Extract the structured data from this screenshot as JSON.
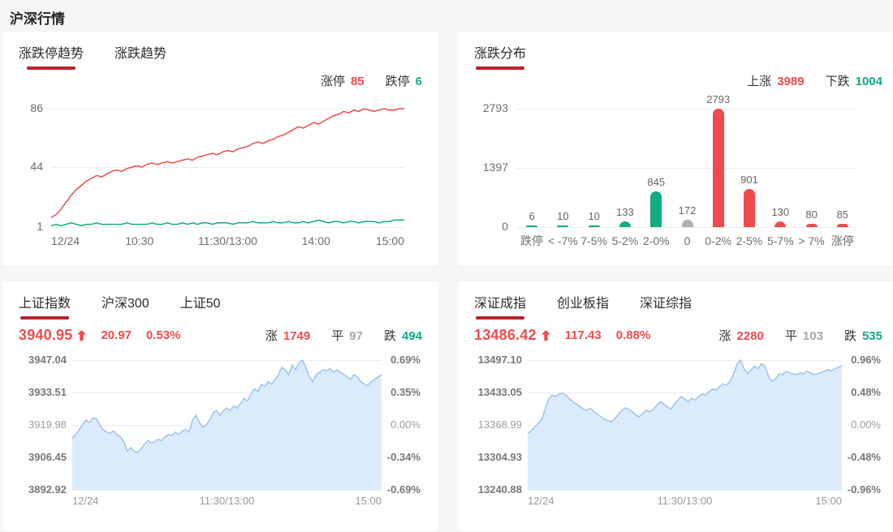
{
  "page": {
    "title": "沪深行情"
  },
  "colors": {
    "red": "#f04a4c",
    "green": "#10ab87",
    "underline": "#b5232c",
    "gray_text": "#a8a8a8",
    "bar_gray": "#b0b0b0",
    "area_line": "#9cc3ee",
    "area_fill": "#dcebfb",
    "grid_line": "#ececec",
    "page_bg": "#f5f6f8",
    "panel_bg": "#ffffff"
  },
  "panels": {
    "limit_trend": {
      "tabs": [
        {
          "label": "涨跌停趋势",
          "active": true
        },
        {
          "label": "涨跌趋势",
          "active": false
        }
      ],
      "stats": [
        {
          "label": "涨停",
          "value": "85",
          "color": "red"
        },
        {
          "label": "跌停",
          "value": "6",
          "color": "green"
        }
      ]
    },
    "distribution": {
      "tabs": [
        {
          "label": "涨跌分布",
          "active": true
        }
      ],
      "stats": [
        {
          "label": "上涨",
          "value": "3989",
          "color": "red"
        },
        {
          "label": "下跌",
          "value": "1004",
          "color": "green"
        }
      ]
    },
    "sh_index": {
      "tabs": [
        {
          "label": "上证指数",
          "active": true
        },
        {
          "label": "沪深300",
          "active": false
        },
        {
          "label": "上证50",
          "active": false
        }
      ],
      "quote": {
        "price": "3940.95",
        "direction": "up",
        "change": "20.97",
        "pct": "0.53%"
      },
      "stats": [
        {
          "label": "涨",
          "value": "1749",
          "color": "red"
        },
        {
          "label": "平",
          "value": "97",
          "color": "gray"
        },
        {
          "label": "跌",
          "value": "494",
          "color": "green"
        }
      ]
    },
    "sz_index": {
      "tabs": [
        {
          "label": "深证成指",
          "active": true
        },
        {
          "label": "创业板指",
          "active": false
        },
        {
          "label": "深证综指",
          "active": false
        }
      ],
      "quote": {
        "price": "13486.42",
        "direction": "up",
        "change": "117.43",
        "pct": "0.88%"
      },
      "stats": [
        {
          "label": "涨",
          "value": "2280",
          "color": "red"
        },
        {
          "label": "平",
          "value": "103",
          "color": "gray"
        },
        {
          "label": "跌",
          "value": "535",
          "color": "green"
        }
      ]
    }
  },
  "chart_data": [
    {
      "type": "line",
      "title": "涨跌停趋势",
      "x_ticks": [
        "12/24",
        "10:30",
        "11:30/13:00",
        "14:00",
        "15:00"
      ],
      "y_ticks": [
        86,
        44,
        1
      ],
      "ylim": [
        1,
        86
      ],
      "grid": true,
      "legend_position": "none",
      "series": [
        {
          "name": "涨停",
          "color_key": "red",
          "values": [
            8,
            10,
            14,
            19,
            24,
            28,
            31,
            34,
            36,
            38,
            37,
            39,
            41,
            42,
            41,
            43,
            44,
            45,
            44,
            46,
            47,
            46,
            47,
            48,
            47,
            48,
            49,
            50,
            49,
            51,
            52,
            53,
            54,
            53,
            55,
            56,
            55,
            57,
            58,
            59,
            61,
            62,
            61,
            63,
            64,
            66,
            67,
            69,
            71,
            73,
            72,
            74,
            76,
            75,
            77,
            79,
            81,
            82,
            84,
            83,
            85,
            84,
            86,
            85,
            84,
            85,
            86,
            85,
            85,
            86,
            86
          ]
        },
        {
          "name": "跌停",
          "color_key": "green",
          "values": [
            2,
            3,
            2,
            3,
            4,
            3,
            2,
            3,
            3,
            4,
            3,
            3,
            3,
            3,
            3,
            4,
            3,
            3,
            3,
            3,
            4,
            3,
            3,
            4,
            3,
            3,
            4,
            3,
            4,
            3,
            4,
            4,
            3,
            4,
            4,
            4,
            3,
            4,
            4,
            4,
            5,
            4,
            4,
            4,
            5,
            4,
            4,
            5,
            4,
            4,
            5,
            4,
            5,
            6,
            5,
            4,
            5,
            5,
            4,
            5,
            5,
            4,
            5,
            5,
            5,
            4,
            5,
            5,
            6,
            6,
            6
          ]
        }
      ]
    },
    {
      "type": "bar",
      "title": "涨跌分布",
      "categories": [
        "跌停",
        "< -7%",
        "7-5%",
        "5-2%",
        "2-0%",
        "0",
        "0-2%",
        "2-5%",
        "5-7%",
        "> 7%",
        "涨停"
      ],
      "values": [
        6,
        10,
        10,
        133,
        845,
        172,
        2793,
        901,
        130,
        80,
        85
      ],
      "bar_colors": [
        "green",
        "green",
        "green",
        "green",
        "green",
        "gray",
        "red",
        "red",
        "red",
        "red",
        "red"
      ],
      "y_ticks": [
        2793,
        1397,
        0
      ],
      "ylim": [
        0,
        2793
      ],
      "grid": true
    },
    {
      "type": "area",
      "title": "上证指数",
      "x_ticks": [
        "12/24",
        "11:30/13:00",
        "15:00"
      ],
      "y_ticks_left": [
        "3947.04",
        "3933.51",
        "3919.98",
        "3906.45",
        "3892.92"
      ],
      "y_ticks_right": [
        "0.69%",
        "0.35%",
        "0.00%",
        "-0.34%",
        "-0.69%"
      ],
      "tick_colors": [
        "red",
        "red",
        "gray",
        "green",
        "green"
      ],
      "ylim": [
        3892.92,
        3947.04
      ],
      "prev_close": 3919.98,
      "grid": true,
      "values": [
        3914.5,
        3916,
        3918,
        3920,
        3922,
        3921,
        3923,
        3922.5,
        3920,
        3918,
        3917,
        3916.5,
        3917.5,
        3916,
        3915,
        3913,
        3909,
        3910.5,
        3909,
        3908.5,
        3910,
        3912,
        3913.5,
        3912.5,
        3913,
        3914,
        3913.5,
        3915,
        3916,
        3915.5,
        3917,
        3916,
        3917.5,
        3918,
        3917,
        3922,
        3924,
        3921,
        3919,
        3920,
        3922,
        3925,
        3926,
        3924,
        3926,
        3927,
        3926,
        3928,
        3927,
        3929,
        3931,
        3930,
        3933,
        3935,
        3934,
        3937,
        3936,
        3938,
        3937,
        3939,
        3941,
        3944,
        3943,
        3941,
        3945,
        3943,
        3946,
        3947,
        3944,
        3940,
        3938,
        3941,
        3942,
        3943,
        3942.5,
        3943.5,
        3942,
        3943,
        3942,
        3941,
        3940,
        3939,
        3941,
        3940,
        3938,
        3937,
        3936.5,
        3938,
        3939,
        3940,
        3941
      ]
    },
    {
      "type": "area",
      "title": "深证成指",
      "x_ticks": [
        "12/24",
        "11:30/13:00",
        "15:00"
      ],
      "y_ticks_left": [
        "13497.10",
        "13433.05",
        "13368.99",
        "13304.93",
        "13240.88"
      ],
      "y_ticks_right": [
        "0.96%",
        "0.48%",
        "0.00%",
        "-0.48%",
        "-0.96%"
      ],
      "tick_colors": [
        "red",
        "red",
        "gray",
        "green",
        "green"
      ],
      "ylim": [
        13240.88,
        13497.1
      ],
      "prev_close": 13368.99,
      "grid": true,
      "values": [
        13352,
        13358,
        13365,
        13372,
        13380,
        13400,
        13420,
        13428,
        13425,
        13430,
        13432,
        13428,
        13420,
        13415,
        13410,
        13405,
        13400,
        13398,
        13402,
        13395,
        13390,
        13385,
        13380,
        13378,
        13375,
        13382,
        13390,
        13398,
        13403,
        13400,
        13395,
        13388,
        13385,
        13392,
        13398,
        13395,
        13400,
        13408,
        13415,
        13410,
        13405,
        13400,
        13410,
        13418,
        13425,
        13420,
        13415,
        13422,
        13418,
        13425,
        13430,
        13428,
        13435,
        13440,
        13438,
        13445,
        13450,
        13448,
        13455,
        13470,
        13490,
        13497,
        13480,
        13470,
        13478,
        13485,
        13480,
        13490,
        13485,
        13465,
        13455,
        13460,
        13470,
        13468,
        13475,
        13472,
        13470,
        13468,
        13472,
        13470,
        13475,
        13472,
        13468,
        13470,
        13472,
        13475,
        13478,
        13476,
        13480,
        13483,
        13486
      ]
    }
  ]
}
